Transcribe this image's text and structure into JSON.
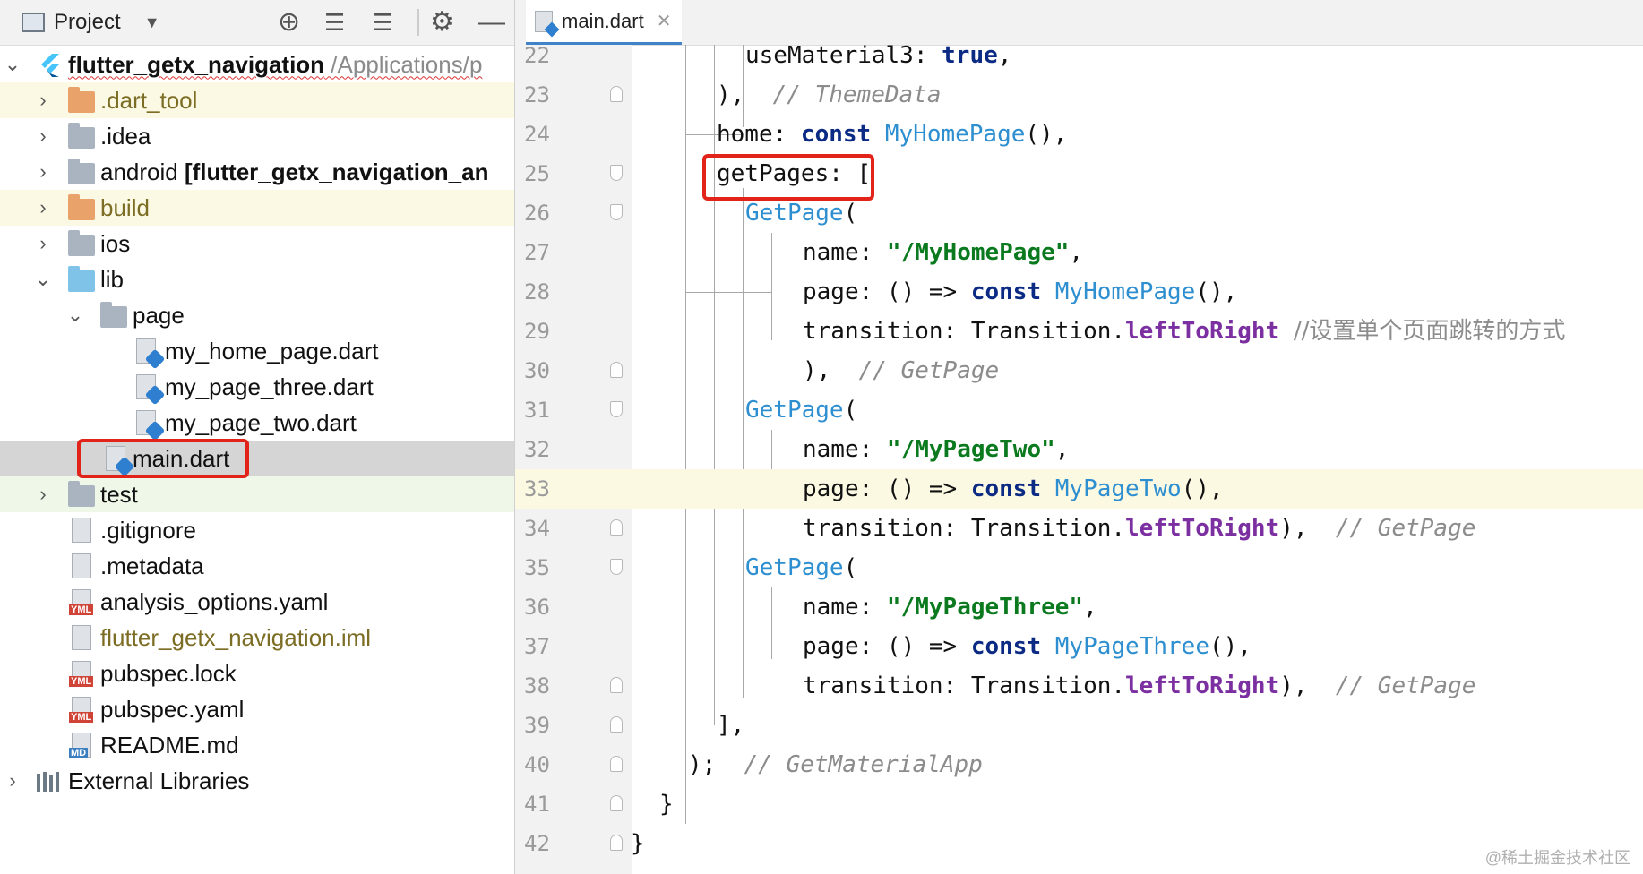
{
  "project_panel": {
    "title": "Project",
    "toolbar_icons": [
      "dropdown-icon",
      "crosshair-icon",
      "expand-all-icon",
      "collapse-all-icon",
      "gear-icon",
      "minimize-icon"
    ],
    "tree": [
      {
        "label": "flutter_getx_navigation",
        "extra": "/Applications/p",
        "icon": "flutter-icon",
        "depth": 0,
        "expanded": true
      },
      {
        "label": ".dart_tool",
        "icon": "folder-icon",
        "depth": 1
      },
      {
        "label": ".idea",
        "icon": "folder-icon",
        "depth": 1
      },
      {
        "label": "android",
        "extra": "[flutter_getx_navigation_an",
        "icon": "folder-icon",
        "depth": 1
      },
      {
        "label": "build",
        "icon": "folder-icon",
        "depth": 1
      },
      {
        "label": "ios",
        "icon": "folder-icon",
        "depth": 1
      },
      {
        "label": "lib",
        "icon": "folder-icon",
        "depth": 1,
        "expanded": true
      },
      {
        "label": "page",
        "icon": "folder-icon",
        "depth": 2,
        "expanded": true
      },
      {
        "label": "my_home_page.dart",
        "icon": "dart-file-icon",
        "depth": 3
      },
      {
        "label": "my_page_three.dart",
        "icon": "dart-file-icon",
        "depth": 3
      },
      {
        "label": "my_page_two.dart",
        "icon": "dart-file-icon",
        "depth": 3
      },
      {
        "label": "main.dart",
        "icon": "dart-file-icon",
        "depth": 2,
        "selected": true
      },
      {
        "label": "test",
        "icon": "folder-icon",
        "depth": 1
      },
      {
        "label": ".gitignore",
        "icon": "file-icon",
        "depth": 1
      },
      {
        "label": ".metadata",
        "icon": "file-icon",
        "depth": 1
      },
      {
        "label": "analysis_options.yaml",
        "icon": "yaml-file-icon",
        "depth": 1
      },
      {
        "label": "flutter_getx_navigation.iml",
        "icon": "iml-file-icon",
        "depth": 1
      },
      {
        "label": "pubspec.lock",
        "icon": "yaml-file-icon",
        "depth": 1
      },
      {
        "label": "pubspec.yaml",
        "icon": "yaml-file-icon",
        "depth": 1
      },
      {
        "label": "README.md",
        "icon": "md-file-icon",
        "depth": 1
      },
      {
        "label": "External Libraries",
        "icon": "libraries-icon",
        "depth": 0
      }
    ]
  },
  "editor": {
    "tab_label": "main.dart",
    "badge_yml": "YML",
    "badge_md": "MD",
    "current_line": "33",
    "lines": [
      {
        "num": "22",
        "code": "useMaterial3: true,"
      },
      {
        "num": "23",
        "code": "),  // ThemeData"
      },
      {
        "num": "24",
        "code": "home: const MyHomePage(),"
      },
      {
        "num": "25",
        "code": "getPages: ["
      },
      {
        "num": "26",
        "code": "GetPage("
      },
      {
        "num": "27",
        "code": "name: \"/MyHomePage\","
      },
      {
        "num": "28",
        "code": "page: () => const MyHomePage(),"
      },
      {
        "num": "29",
        "code": "transition: Transition.leftToRight //设置单个页面跳转的方式"
      },
      {
        "num": "30",
        "code": "),  // GetPage"
      },
      {
        "num": "31",
        "code": "GetPage("
      },
      {
        "num": "32",
        "code": "name: \"/MyPageTwo\","
      },
      {
        "num": "33",
        "code": "page: () => const MyPageTwo(),"
      },
      {
        "num": "34",
        "code": "transition: Transition.leftToRight),  // GetPage"
      },
      {
        "num": "35",
        "code": "GetPage("
      },
      {
        "num": "36",
        "code": "name: \"/MyPageThree\","
      },
      {
        "num": "37",
        "code": "page: () => const MyPageThree(),"
      },
      {
        "num": "38",
        "code": "transition: Transition.leftToRight),  // GetPage"
      },
      {
        "num": "39",
        "code": "],"
      },
      {
        "num": "40",
        "code": ");  // GetMaterialApp"
      },
      {
        "num": "41",
        "code": "}"
      },
      {
        "num": "42",
        "code": "}"
      }
    ]
  },
  "code_tokens": {
    "useMaterial3": "useMaterial3: ",
    "true": "true",
    "comma": ",",
    "close_paren_comma": "),",
    "cmt_themedata": "// ThemeData",
    "home": "home: ",
    "const": "const",
    "MyHomePage": "MyHomePage",
    "parens_comma": "(),",
    "getPages": "getPages: [",
    "GetPage": "GetPage",
    "open_paren": "(",
    "name": "name: ",
    "str_home": "\"/MyHomePage\"",
    "str_two": "\"/MyPageTwo\"",
    "str_three": "\"/MyPageThree\"",
    "page": "page: () => ",
    "MyPageTwo": "MyPageTwo",
    "MyPageThree": "MyPageThree",
    "transition": "transition: Transition.",
    "leftToRight": "leftToRight",
    "cmt_chinese": "//设置单个页面跳转的方式",
    "cmt_getpage": "// GetPage",
    "close_paren_comma2": "),",
    "close_bracket": "],",
    "close_paren_semi": ");",
    "cmt_getmaterialapp": "// GetMaterialApp",
    "close_brace": "}"
  },
  "watermark": "@稀土掘金技术社区",
  "colors": {
    "highlight_box": "#e2231a",
    "keyword": "#0b2a84",
    "string": "#0b7a1f",
    "class": "#2e8fd0",
    "comment": "#8c8c8c",
    "field": "#7b2fa0"
  }
}
